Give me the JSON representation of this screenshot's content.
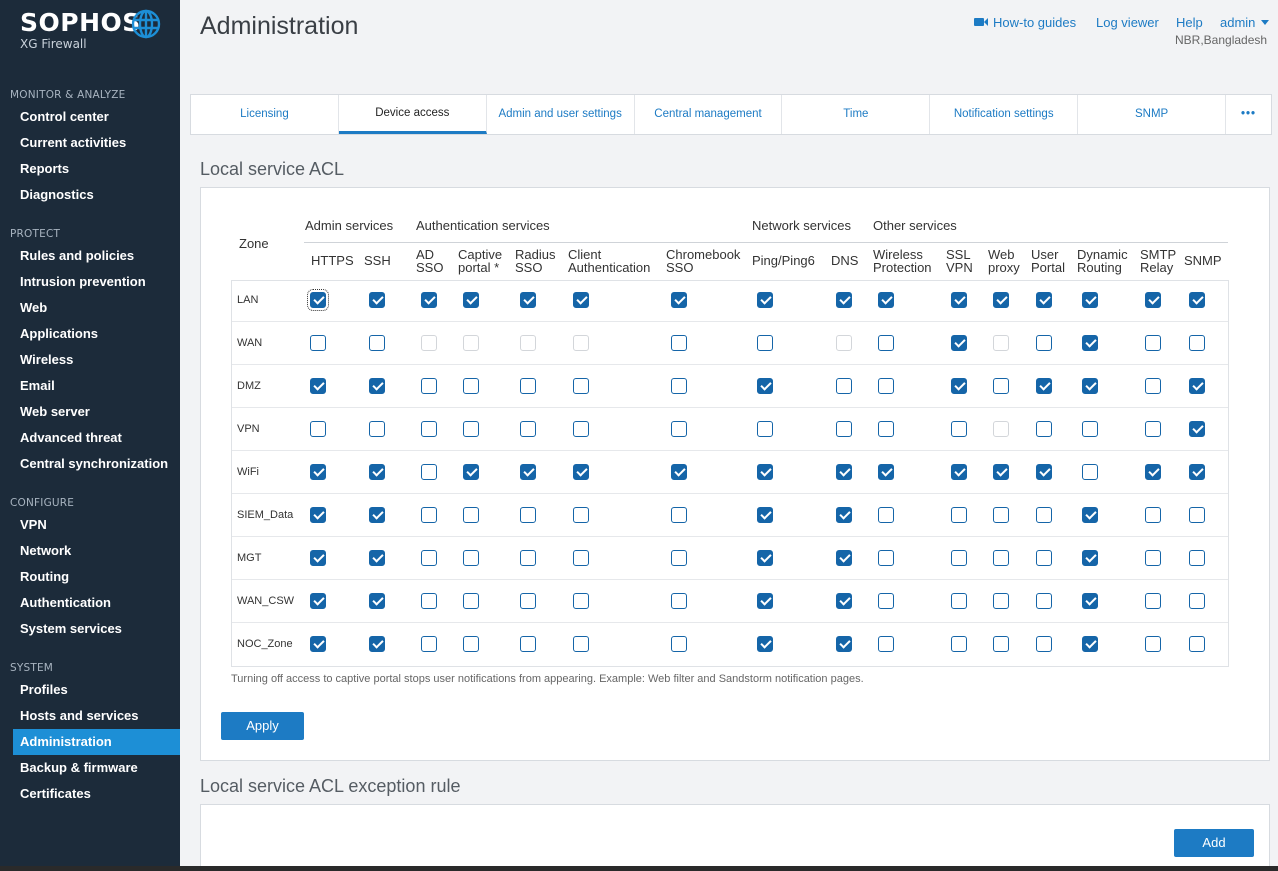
{
  "brand": {
    "name": "SOPHOS",
    "product": "XG Firewall"
  },
  "sidebar": {
    "sections": [
      {
        "title": "MONITOR & ANALYZE",
        "items": [
          "Control center",
          "Current activities",
          "Reports",
          "Diagnostics"
        ]
      },
      {
        "title": "PROTECT",
        "items": [
          "Rules and policies",
          "Intrusion prevention",
          "Web",
          "Applications",
          "Wireless",
          "Email",
          "Web server",
          "Advanced threat",
          "Central synchronization"
        ]
      },
      {
        "title": "CONFIGURE",
        "items": [
          "VPN",
          "Network",
          "Routing",
          "Authentication",
          "System services"
        ]
      },
      {
        "title": "SYSTEM",
        "items": [
          "Profiles",
          "Hosts and services",
          "Administration",
          "Backup & firmware",
          "Certificates"
        ]
      }
    ],
    "active_item": "Administration"
  },
  "header": {
    "title": "Administration",
    "links": {
      "howto": "How-to guides",
      "log_viewer": "Log viewer",
      "help": "Help",
      "user": "admin"
    },
    "location": "NBR,Bangladesh"
  },
  "tabs": [
    "Licensing",
    "Device access",
    "Admin and user settings",
    "Central management",
    "Time",
    "Notification settings",
    "SNMP",
    "•••"
  ],
  "active_tab": "Device access",
  "acl": {
    "title": "Local service ACL",
    "zone_header": "Zone",
    "groups": [
      "Admin services",
      "Authentication services",
      "Network services",
      "Other services"
    ],
    "columns": [
      [
        "HTTPS"
      ],
      [
        "SSH"
      ],
      [
        "AD",
        "SSO"
      ],
      [
        "Captive",
        "portal *"
      ],
      [
        "Radius",
        "SSO"
      ],
      [
        "Client",
        "Authentication"
      ],
      [
        "Chromebook",
        "SSO"
      ],
      [
        "Ping/Ping6"
      ],
      [
        "DNS"
      ],
      [
        "Wireless",
        "Protection"
      ],
      [
        "SSL",
        "VPN"
      ],
      [
        "Web",
        "proxy"
      ],
      [
        "User",
        "Portal"
      ],
      [
        "Dynamic",
        "Routing"
      ],
      [
        "SMTP",
        "Relay"
      ],
      [
        "SNMP"
      ]
    ],
    "rows": [
      {
        "zone": "LAN",
        "states": "1111111111111111"
      },
      {
        "zone": "WAN",
        "states": "00dddd00d01d0100"
      },
      {
        "zone": "DMZ",
        "states": "1100000100101101"
      },
      {
        "zone": "VPN",
        "states": "00000000000d0001"
      },
      {
        "zone": "WiFi",
        "states": "1101111111111011"
      },
      {
        "zone": "SIEM_Data",
        "states": "1100000110000100"
      },
      {
        "zone": "MGT",
        "states": "1100000110000100"
      },
      {
        "zone": "WAN_CSW",
        "states": "1100000110000100"
      },
      {
        "zone": "NOC_Zone",
        "states": "1100000110000100"
      }
    ],
    "note": "Turning off access to captive portal stops user notifications from appearing. Example: Web filter and Sandstorm notification pages.",
    "apply_label": "Apply"
  },
  "exception": {
    "title": "Local service ACL exception rule",
    "add_label": "Add"
  }
}
